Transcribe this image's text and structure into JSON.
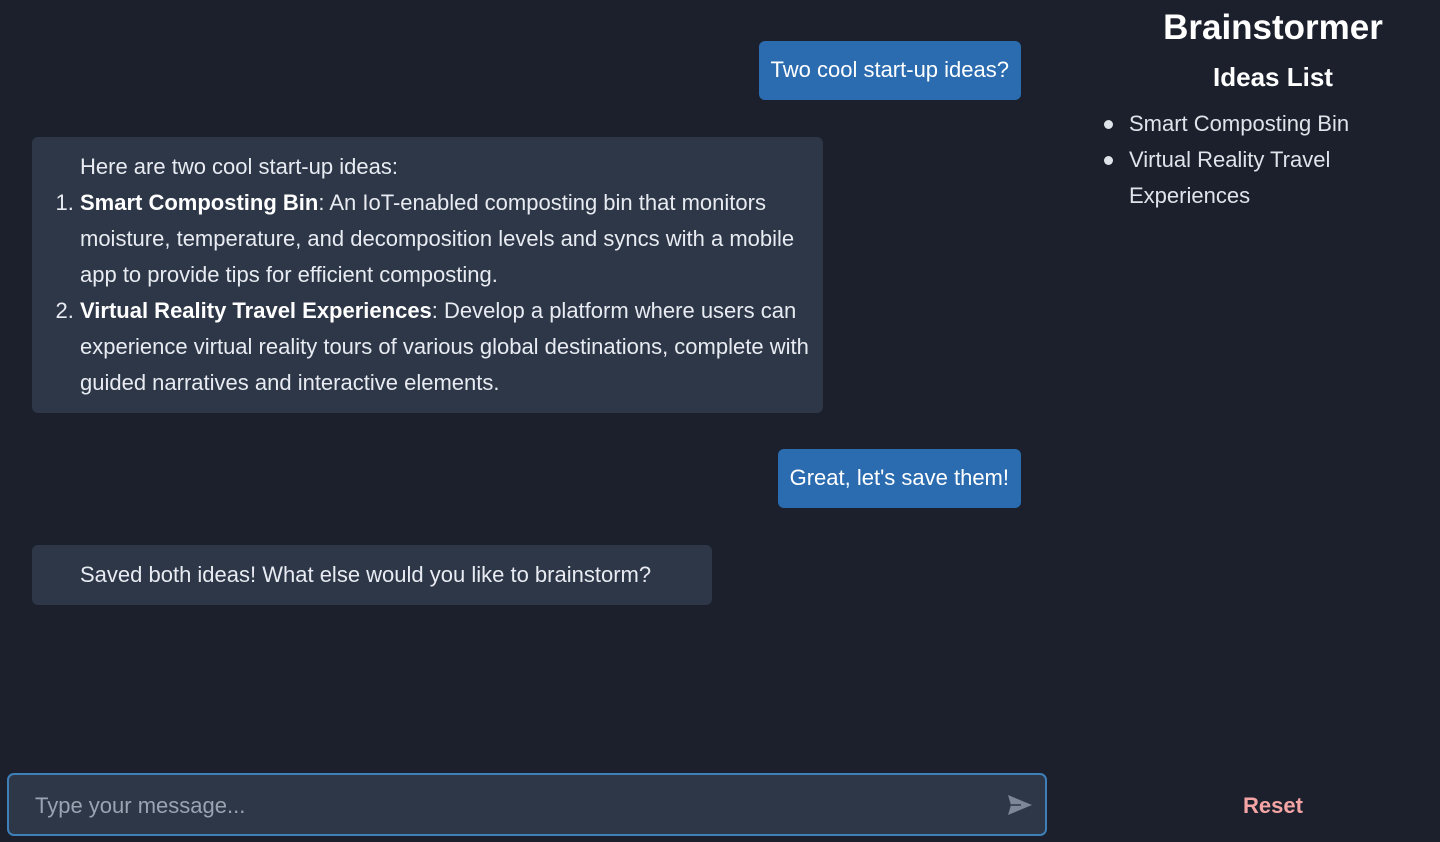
{
  "app": {
    "title": "Brainstormer"
  },
  "sidebar": {
    "ideas_title": "Ideas List",
    "ideas": [
      "Smart Composting Bin",
      "Virtual Reality Travel Experiences"
    ],
    "reset_label": "Reset"
  },
  "messages": [
    {
      "role": "user",
      "text": "Two cool start-up ideas?"
    },
    {
      "role": "assistant",
      "intro": "Here are two cool start-up ideas:",
      "items": [
        {
          "title": "Smart Composting Bin",
          "body": ": An IoT-enabled composting bin that monitors moisture, temperature, and decomposition levels and syncs with a mobile app to provide tips for efficient composting."
        },
        {
          "title": "Virtual Reality Travel Experiences",
          "body": ": Develop a platform where users can experience virtual reality tours of various global destinations, complete with guided narratives and interactive elements."
        }
      ]
    },
    {
      "role": "user",
      "text": "Great, let's save them!"
    },
    {
      "role": "assistant",
      "text": "Saved both ideas! What else would you like to brainstorm?"
    }
  ],
  "composer": {
    "placeholder": "Type your message...",
    "send_icon": "send-icon"
  },
  "colors": {
    "background": "#1b202c",
    "user_bubble": "#2b6cb0",
    "bot_bubble": "#2d3748",
    "reset": "#f4a4a4"
  }
}
